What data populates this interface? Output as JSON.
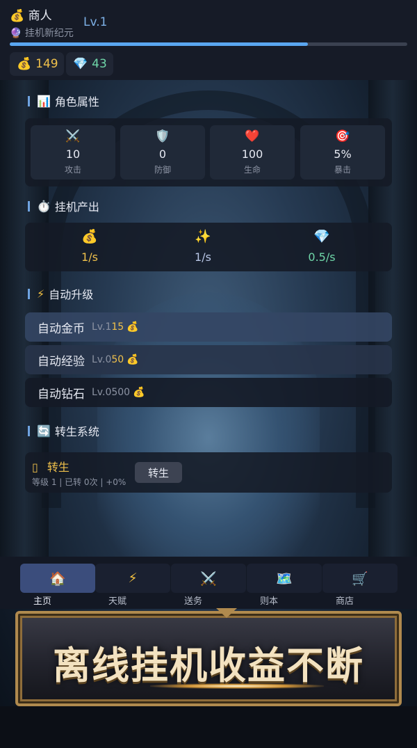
{
  "header": {
    "title": "商人",
    "level": "Lv.1",
    "era": "挂机新纪元",
    "xp_progress": 0.75,
    "gold": "149",
    "diamond": "43"
  },
  "sections": {
    "attributes": "角色属性",
    "idle_output": "挂机产出",
    "auto_upgrade": "自动升级",
    "rebirth": "转生系统"
  },
  "stats": [
    {
      "icon": "swords-icon",
      "value": "10",
      "label": "攻击"
    },
    {
      "icon": "shield-icon",
      "value": "0",
      "label": "防御"
    },
    {
      "icon": "heart-icon",
      "value": "100",
      "label": "生命"
    },
    {
      "icon": "target-icon",
      "value": "5%",
      "label": "暴击"
    }
  ],
  "output": [
    {
      "icon": "moneybag-icon",
      "value": "1/s",
      "color": "#f0c14b"
    },
    {
      "icon": "sparkle-icon",
      "value": "1/s",
      "color": "#b9c7e6"
    },
    {
      "icon": "diamond-icon",
      "value": "0.5/s",
      "color": "#6fd6a8"
    }
  ],
  "upgrades": [
    {
      "name": "自动金币",
      "level": "Lv.1",
      "cost": "15"
    },
    {
      "name": "自动经验",
      "level": "Lv.0",
      "cost": "50"
    },
    {
      "name": "自动钻石",
      "level": "Lv.0",
      "cost": "500"
    }
  ],
  "rebirth": {
    "title": "转生",
    "info": "等级 1 | 已转 0次 | +0%",
    "button": "转生"
  },
  "nav": [
    {
      "label": "主页",
      "icon": "home-icon"
    },
    {
      "label": "天赋",
      "icon": "lightning-icon"
    },
    {
      "label": "送务",
      "icon": "swords-icon"
    },
    {
      "label": "则本",
      "icon": "map-icon"
    },
    {
      "label": "商店",
      "icon": "cart-icon"
    }
  ],
  "banner": {
    "text": "离线挂机收益不断"
  },
  "colors": {
    "accent": "#5aa6f0",
    "gold": "#f0c14b",
    "gem": "#6fd6a8",
    "active_tab": "#3b4d7c"
  }
}
